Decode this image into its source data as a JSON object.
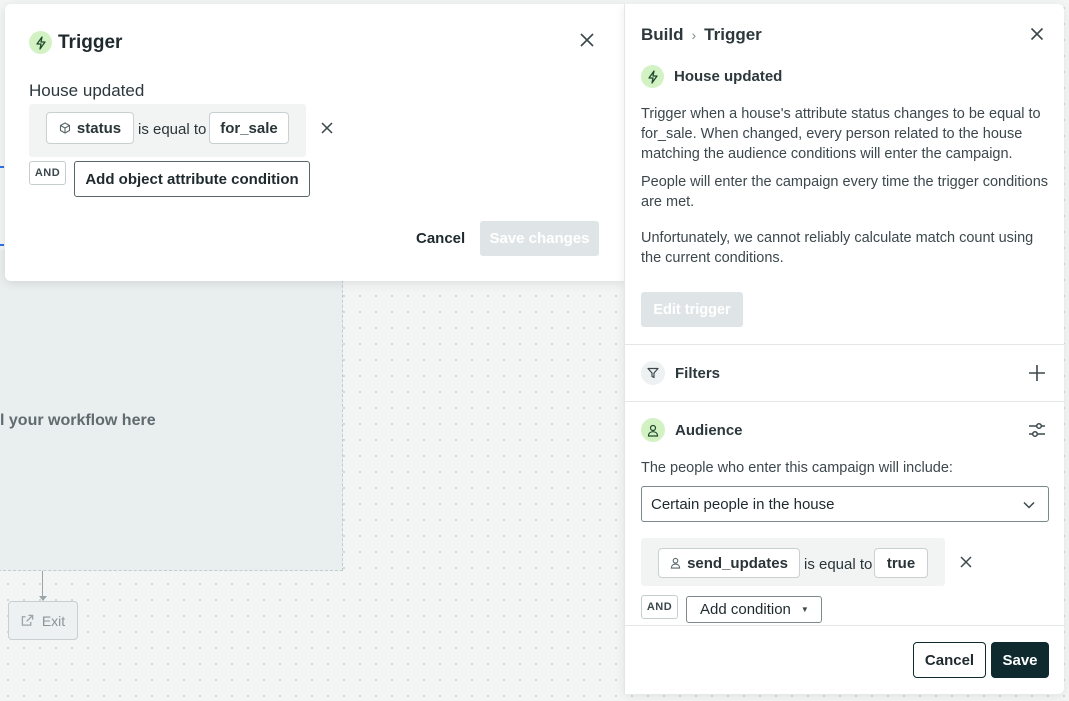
{
  "canvas": {
    "drop_text": "l your workflow here",
    "exit_label": "Exit"
  },
  "modal": {
    "title": "Trigger",
    "section_title": "House updated",
    "condition": {
      "attribute": "status",
      "operator": "is equal to",
      "value": "for_sale"
    },
    "and_label": "AND",
    "add_condition_label": "Add object attribute condition",
    "cancel_label": "Cancel",
    "save_label": "Save changes"
  },
  "panel": {
    "breadcrumb": [
      "Build",
      "Trigger"
    ],
    "trigger_title": "House updated",
    "description_1": "Trigger when a house's attribute status changes to be equal to for_sale. When changed, every person related to the house matching the audience conditions will enter the campaign.",
    "description_2": "People will enter the campaign every time the trigger conditions are met.",
    "description_3": "Unfortunately, we cannot reliably calculate match count using the current conditions.",
    "edit_trigger_label": "Edit trigger",
    "filters_label": "Filters",
    "audience_label": "Audience",
    "audience_intro": "The people who enter this campaign will include:",
    "audience_select_value": "Certain people in the house",
    "audience_condition": {
      "attribute": "send_updates",
      "operator": "is equal to",
      "value": "true"
    },
    "and_label": "AND",
    "add_condition_label": "Add condition",
    "cancel_label": "Cancel",
    "save_label": "Save"
  },
  "colors": {
    "bolt_badge": "#d3f2c4",
    "dark_button": "#0f2a2e",
    "disabled_button": "#dfe5e6",
    "accent_line": "#2f6fe8"
  },
  "icons": {
    "trigger": "bolt-icon",
    "close": "close-icon",
    "object": "cube-icon",
    "filter": "funnel-icon",
    "audience": "person-icon",
    "settings": "sliders-icon",
    "add": "plus-icon",
    "exit": "external-link-icon"
  }
}
